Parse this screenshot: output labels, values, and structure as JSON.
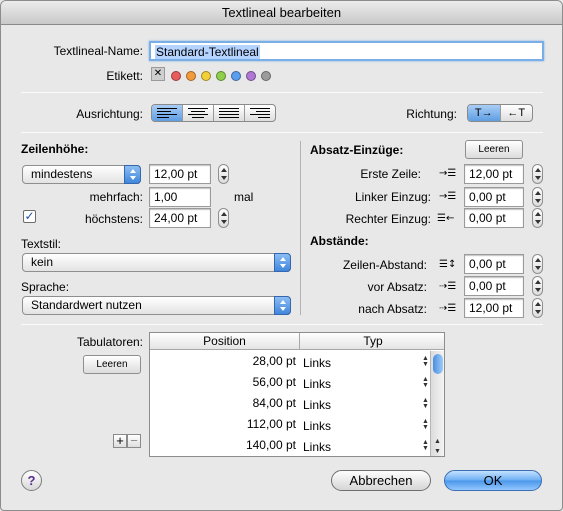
{
  "window": {
    "title": "Textlineal bearbeiten"
  },
  "name": {
    "label": "Textlineal-Name:",
    "value": "Standard-Textlineal"
  },
  "label_row": {
    "label": "Etikett:",
    "clear_glyph": "✕",
    "colors": [
      "#e85c5c",
      "#f39b3b",
      "#f2d03a",
      "#8fcf4b",
      "#5a9ef0",
      "#b077d6",
      "#9c9c9c"
    ]
  },
  "alignment": {
    "label": "Ausrichtung:",
    "options": [
      "left",
      "center",
      "justify",
      "right"
    ],
    "selected": "left"
  },
  "direction": {
    "label": "Richtung:",
    "options": [
      "T→",
      "←T"
    ],
    "selected": "T→"
  },
  "line_height": {
    "header": "Zeilenhöhe:",
    "mode": "mindestens",
    "value": "12,00 pt",
    "multiple_label": "mehrfach:",
    "multiple_value": "1,00",
    "multiple_unit": "mal",
    "max_checked": true,
    "max_label": "höchstens:",
    "max_value": "24,00 pt"
  },
  "text_style": {
    "label": "Textstil:",
    "value": "kein"
  },
  "language": {
    "label": "Sprache:",
    "value": "Standardwert nutzen"
  },
  "indents": {
    "header": "Absatz-Einzüge:",
    "clear_button": "Leeren",
    "first_line_label": "Erste Zeile:",
    "first_line_value": "12,00 pt",
    "left_label": "Linker Einzug:",
    "left_value": "0,00 pt",
    "right_label": "Rechter Einzug:",
    "right_value": "0,00 pt"
  },
  "spacing": {
    "header": "Abstände:",
    "line_label": "Zeilen-Abstand:",
    "line_value": "0,00 pt",
    "before_label": "vor Absatz:",
    "before_value": "0,00 pt",
    "after_label": "nach Absatz:",
    "after_value": "12,00 pt"
  },
  "tabs": {
    "label": "Tabulatoren:",
    "clear_button": "Leeren",
    "columns": [
      "Position",
      "Typ"
    ],
    "rows": [
      {
        "position": "28,00 pt",
        "type": "Links"
      },
      {
        "position": "56,00 pt",
        "type": "Links"
      },
      {
        "position": "84,00 pt",
        "type": "Links"
      },
      {
        "position": "112,00 pt",
        "type": "Links"
      },
      {
        "position": "140,00 pt",
        "type": "Links"
      }
    ],
    "add_glyph": "+",
    "remove_glyph": "−"
  },
  "buttons": {
    "help": "?",
    "cancel": "Abbrechen",
    "ok": "OK"
  }
}
